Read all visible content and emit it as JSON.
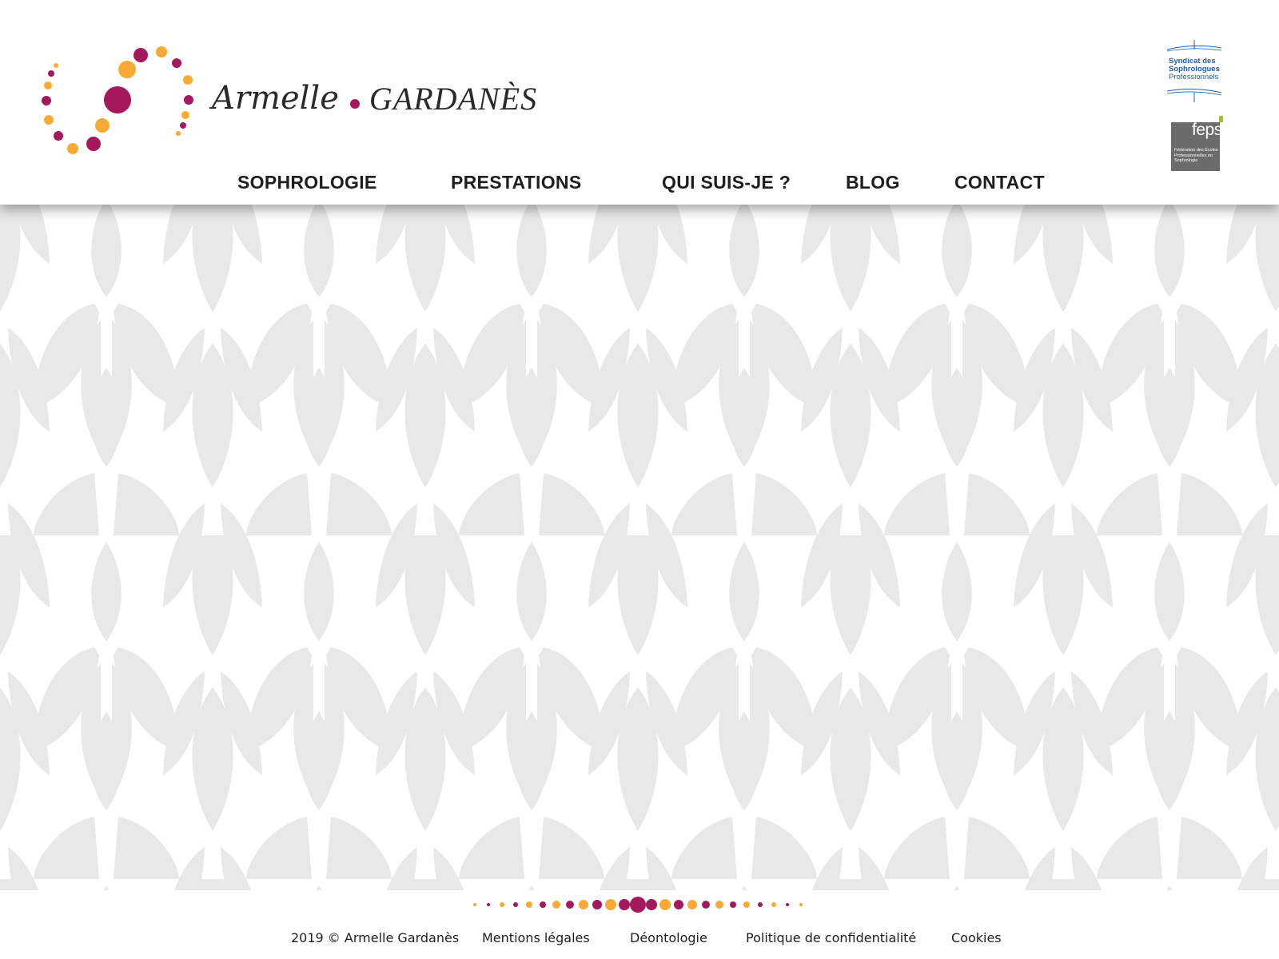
{
  "brand": {
    "first_name": "Armelle",
    "last_name": "GARDANÈS"
  },
  "nav": {
    "items": [
      {
        "label": "SOPHROLOGIE"
      },
      {
        "label": "PRESTATIONS"
      },
      {
        "label": "QUI SUIS-JE ?"
      },
      {
        "label": "BLOG"
      },
      {
        "label": "CONTACT"
      }
    ]
  },
  "badges": {
    "ssp": {
      "line1": "Syndicat des",
      "line2": "Sophrologues",
      "line3": "Professionnels"
    },
    "feps": {
      "word": "feps",
      "subtitle": "Fédération des Écoles Professionnelles en Sophrologie"
    }
  },
  "footer": {
    "copyright": "2019 © Armelle Gardanès",
    "links": [
      {
        "label": "Mentions légales"
      },
      {
        "label": "Déontologie"
      },
      {
        "label": "Politique de confidentialité"
      },
      {
        "label": "Cookies"
      }
    ]
  },
  "colors": {
    "magenta": "#a3195b",
    "orange": "#f7ab35",
    "pattern_leaf": "#e8e8e8",
    "pattern_background": "#ffffff",
    "ssp_blue": "#1d5fae",
    "feps_grey": "#6b6b6b",
    "feps_green": "#a9c11f"
  },
  "icons": {
    "logo": "dotted-spiral-logo",
    "divider": "dotted-divider"
  }
}
